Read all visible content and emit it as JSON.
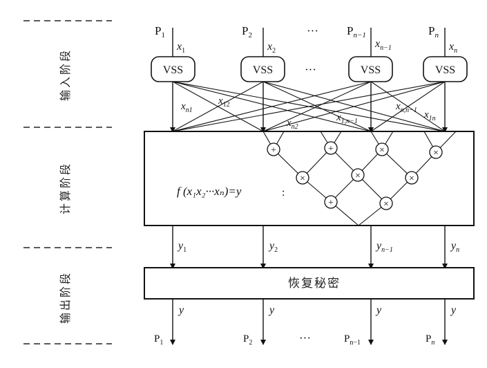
{
  "stages": {
    "input": "输入阶段",
    "compute": "计算阶段",
    "output": "输出阶段"
  },
  "parties": {
    "top": [
      "P",
      "P",
      "P",
      "P"
    ],
    "top_sub": [
      "1",
      "2",
      "n−1",
      "n"
    ],
    "ellipsis": "···"
  },
  "inputs": {
    "base": "x",
    "subs": [
      "1",
      "2",
      "n−1",
      "n"
    ]
  },
  "vss": {
    "label": "VSS",
    "ellipsis": "···"
  },
  "shares": {
    "base": "x",
    "subs": [
      "n1",
      "12",
      "n2",
      "1,n−1",
      "n,n−1",
      "1n"
    ]
  },
  "compute": {
    "function_label": "f (x₁x₂···xₙ)=y",
    "dots": ":",
    "plus_symbol": "+",
    "times_symbol": "×"
  },
  "outputs": {
    "base": "y",
    "subs": [
      "1",
      "2",
      "n−1",
      "n"
    ],
    "final": "y"
  },
  "recover": {
    "label": "恢复秘密"
  },
  "bottom_parties": {
    "base": "P",
    "subs": [
      "1",
      "2",
      "n−1",
      "n"
    ],
    "ellipsis": "···"
  }
}
